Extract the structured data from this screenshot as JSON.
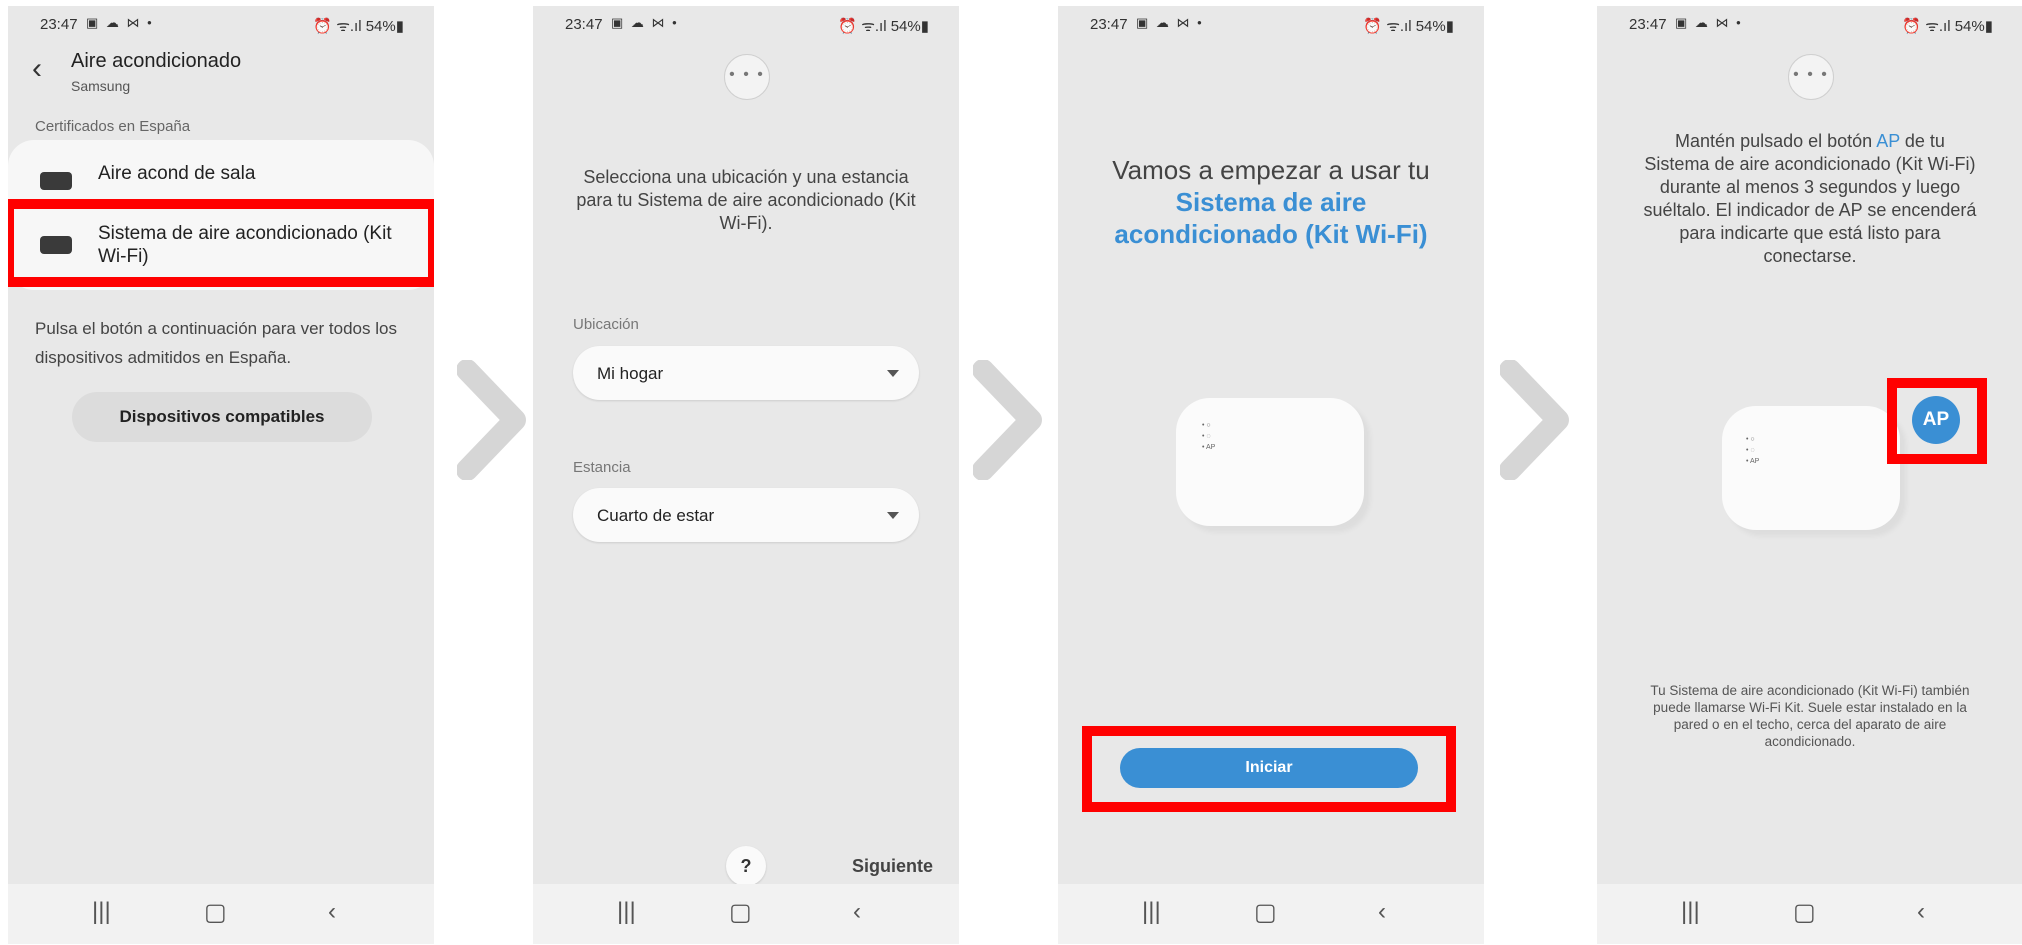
{
  "status": {
    "time": "23:47",
    "notif_icons": "▣ ☁ ⋈ •",
    "right": "⏰ ᯤ.ıl 54%▮"
  },
  "nav": {
    "recent": "|||",
    "home": "▢",
    "back": "‹"
  },
  "colors": {
    "accent": "#3a8fd4",
    "highlight": "#ff0000",
    "screen_bg": "#e8e8e8",
    "arrow": "#d6d6d6"
  },
  "panel1": {
    "back_icon": "‹",
    "title": "Aire acondicionado",
    "subtitle": "Samsung",
    "section": "Certificados en España",
    "items": [
      {
        "label": "Aire acond de sala"
      },
      {
        "label": "Sistema de aire acondicionado (Kit Wi-Fi)"
      }
    ],
    "info": "Pulsa el botón a continuación para ver todos los dispositivos admitidos en España.",
    "button": "Dispositivos compatibles"
  },
  "panel2": {
    "menu": "• • •",
    "instruction": "Selecciona una ubicación y una estancia para tu Sistema de aire acondicionado (Kit Wi-Fi).",
    "location_label": "Ubicación",
    "location_value": "Mi hogar",
    "room_label": "Estancia",
    "room_value": "Cuarto de estar",
    "help": "?",
    "next": "Siguiente"
  },
  "panel3": {
    "title_plain": "Vamos a empezar a usar tu",
    "title_accent": "Sistema de aire acondicionado (Kit Wi-Fi)",
    "device_leds": "• ○\n• ◌\n• AP",
    "button": "Iniciar"
  },
  "panel4": {
    "menu": "• • •",
    "instr_before": "Mantén pulsado el botón",
    "instr_accent": "AP",
    "instr_after": "de tu Sistema de aire acondicionado (Kit Wi-Fi) durante al menos 3 segundos y luego suéltalo. El indicador de AP se encenderá para indicarte que está listo para conectarse.",
    "device_leds": "• ○\n• ◌\n• AP",
    "ap_badge": "AP",
    "footnote": "Tu Sistema de aire acondicionado (Kit Wi-Fi) también puede llamarse Wi-Fi Kit. Suele estar instalado en la pared o en el techo, cerca del aparato de aire acondicionado."
  }
}
